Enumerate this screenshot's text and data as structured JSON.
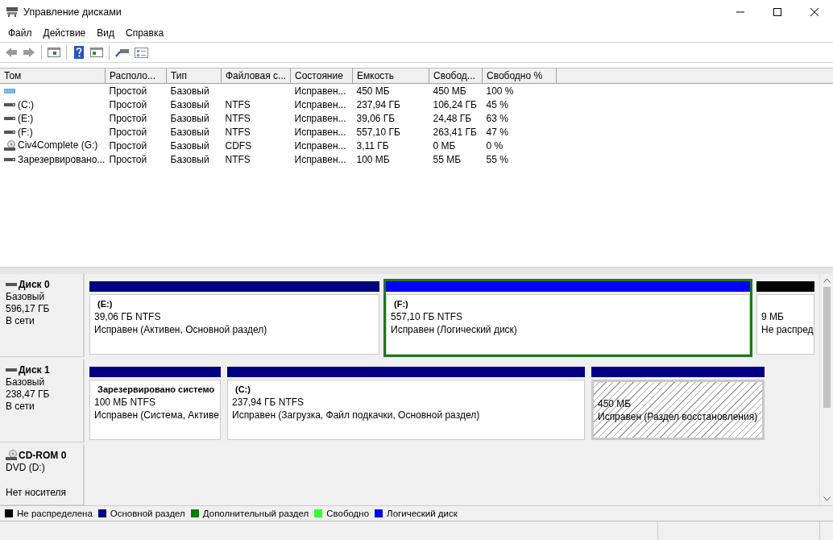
{
  "window": {
    "title": "Управление дисками"
  },
  "menu": [
    "Файл",
    "Действие",
    "Вид",
    "Справка"
  ],
  "toolbar": [
    {
      "kind": "back"
    },
    {
      "kind": "forward"
    },
    {
      "kind": "sep"
    },
    {
      "kind": "panel"
    },
    {
      "kind": "sep"
    },
    {
      "kind": "help"
    },
    {
      "kind": "panel2"
    },
    {
      "kind": "sep"
    },
    {
      "kind": "connect"
    },
    {
      "kind": "props"
    }
  ],
  "table": {
    "columns": [
      "Том",
      "Располо...",
      "Тип",
      "Файловая с...",
      "Состояние",
      "Емкость",
      "Свобод...",
      "Свободно %"
    ],
    "rows": [
      {
        "kind": "recovery",
        "cells": [
          "",
          "Простой",
          "Базовый",
          "",
          "Исправен...",
          "450 МБ",
          "450 МБ",
          "100 %"
        ]
      },
      {
        "kind": "disk",
        "cells": [
          "(C:)",
          "Простой",
          "Базовый",
          "NTFS",
          "Исправен...",
          "237,94 ГБ",
          "106,24 ГБ",
          "45 %"
        ]
      },
      {
        "kind": "disk",
        "cells": [
          "(E:)",
          "Простой",
          "Базовый",
          "NTFS",
          "Исправен...",
          "39,06 ГБ",
          "24,48 ГБ",
          "63 %"
        ]
      },
      {
        "kind": "disk",
        "cells": [
          "(F:)",
          "Простой",
          "Базовый",
          "NTFS",
          "Исправен...",
          "557,10 ГБ",
          "263,41 ГБ",
          "47 %"
        ]
      },
      {
        "kind": "cd",
        "cells": [
          "Civ4Complete (G:)",
          "Простой",
          "Базовый",
          "CDFS",
          "Исправен...",
          "3,11 ГБ",
          "0 МБ",
          "0 %"
        ]
      },
      {
        "kind": "disk",
        "cells": [
          "Зарезервировано...",
          "Простой",
          "Базовый",
          "NTFS",
          "Исправен...",
          "100 МБ",
          "55 МБ",
          "55 %"
        ]
      }
    ]
  },
  "disks": [
    {
      "kind": "disk",
      "name": "Диск 0",
      "lines": [
        "Базовый",
        "596,17 ГБ",
        "В сети"
      ],
      "partitions": [
        {
          "kind": "primary",
          "name": "(E:)",
          "size": "39,06 ГБ NTFS",
          "status": "Исправен (Активен, Основной раздел)",
          "selected": false,
          "hatched": false
        },
        {
          "kind": "logical",
          "name": "(F:)",
          "size": "557,10 ГБ NTFS",
          "status": "Исправен (Логический диск)",
          "selected": true,
          "hatched": false
        },
        {
          "kind": "unallocated",
          "size": "9 МБ",
          "status": "Не распред",
          "selected": false,
          "hatched": false
        }
      ]
    },
    {
      "kind": "disk",
      "name": "Диск 1",
      "lines": [
        "Базовый",
        "238,47 ГБ",
        "В сети"
      ],
      "partitions": [
        {
          "kind": "primary",
          "name": "Зарезервировано системо",
          "size": "100 МБ NTFS",
          "status": "Исправен (Система, Активе",
          "selected": false,
          "hatched": false
        },
        {
          "kind": "primary",
          "name": "(C:)",
          "size": "237,94 ГБ NTFS",
          "status": "Исправен (Загрузка, Файл подкачки, Основной раздел)",
          "selected": false,
          "hatched": false
        },
        {
          "kind": "primary",
          "size": "450 МБ",
          "status": "Исправен (Раздел восстановления)",
          "selected": false,
          "hatched": true
        }
      ]
    },
    {
      "kind": "cd",
      "name": "CD-ROM 0",
      "lines": [
        "DVD (D:)"
      ],
      "note": "Нет носителя"
    }
  ],
  "legend": [
    {
      "label": "Не распределена",
      "color": "#000000"
    },
    {
      "label": "Основной раздел",
      "color": "#000080"
    },
    {
      "label": "Дополнительный раздел",
      "color": "#008000"
    },
    {
      "label": "Свободно",
      "color": "#33ff33"
    },
    {
      "label": "Логический диск",
      "color": "#0000ff"
    }
  ]
}
